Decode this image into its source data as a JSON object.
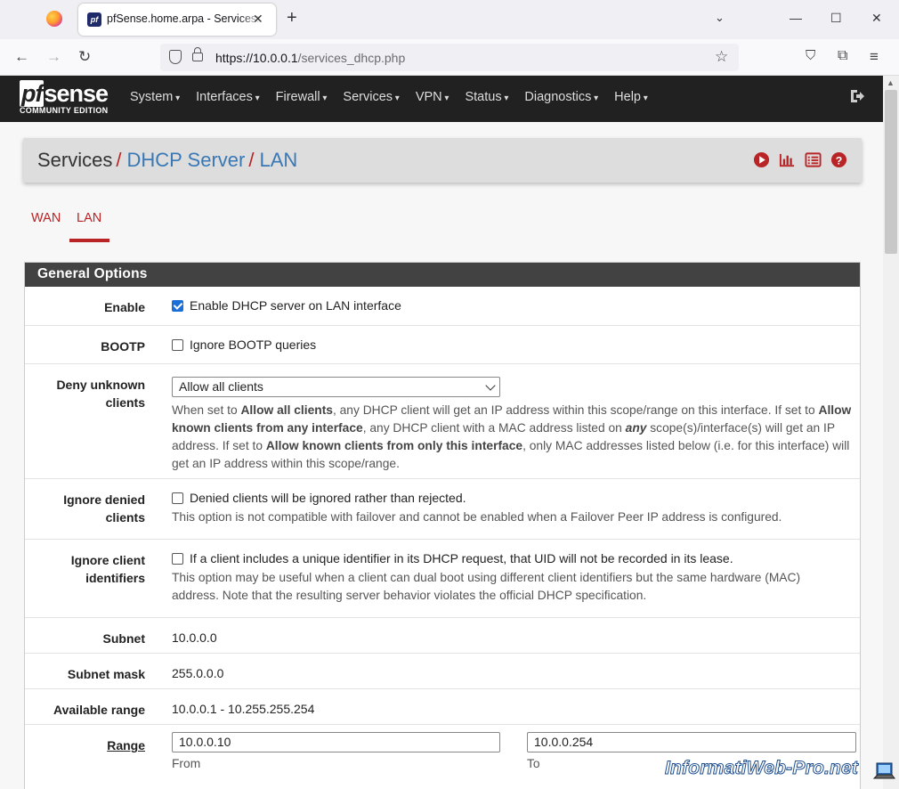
{
  "browser": {
    "tab_title": "pfSense.home.arpa - Services: DHCP Server: LAN",
    "tab_favicon": "pf",
    "url_host": "https://10.0.0.1",
    "url_path": "/services_dhcp.php"
  },
  "pf": {
    "logo_main": "sense",
    "logo_pf": "pf",
    "logo_sub": "COMMUNITY EDITION",
    "menu": [
      "System",
      "Interfaces",
      "Firewall",
      "Services",
      "VPN",
      "Status",
      "Diagnostics",
      "Help"
    ]
  },
  "breadcrumb": {
    "item1": "Services",
    "item2": "DHCP Server",
    "item3": "LAN",
    "separator": "/"
  },
  "tabs": {
    "wan": "WAN",
    "lan": "LAN"
  },
  "panel": {
    "heading": "General Options",
    "enable": {
      "label": "Enable",
      "text": "Enable DHCP server on LAN interface",
      "checked": true
    },
    "bootp": {
      "label": "BOOTP",
      "text": "Ignore BOOTP queries"
    },
    "deny_unknown": {
      "label_line1": "Deny unknown",
      "label_line2": "clients",
      "selected": "Allow all clients",
      "help_p1": "When set to ",
      "help_b1": "Allow all clients",
      "help_p2": ", any DHCP client will get an IP address within this scope/range on this interface. If set to ",
      "help_b2": "Allow known clients from any interface",
      "help_p3": ", any DHCP client with a MAC address listed on ",
      "help_b3": "any",
      "help_p4": " scope(s)/interface(s) will get an IP address. If set to ",
      "help_b4": "Allow known clients from only this interface",
      "help_p5": ", only MAC addresses listed below (i.e. for this interface) will get an IP address within this scope/range."
    },
    "ignore_denied": {
      "label_line1": "Ignore denied",
      "label_line2": "clients",
      "text": "Denied clients will be ignored rather than rejected.",
      "help": "This option is not compatible with failover and cannot be enabled when a Failover Peer IP address is configured."
    },
    "ignore_client_ids": {
      "label_line1": "Ignore client",
      "label_line2": "identifiers",
      "text": "If a client includes a unique identifier in its DHCP request, that UID will not be recorded in its lease.",
      "help": "This option may be useful when a client can dual boot using different client identifiers but the same hardware (MAC) address. Note that the resulting server behavior violates the official DHCP specification."
    },
    "subnet": {
      "label": "Subnet",
      "value": "10.0.0.0"
    },
    "subnet_mask": {
      "label": "Subnet mask",
      "value": "255.0.0.0"
    },
    "available_range": {
      "label": "Available range",
      "value": "10.0.0.1 - 10.255.255.254"
    },
    "range": {
      "label": "Range",
      "from_value": "10.0.0.10",
      "to_value": "10.0.0.254",
      "from_label": "From",
      "to_label": "To"
    }
  },
  "watermark": "InformatiWeb-Pro.net",
  "colors": {
    "accent_red": "#b92426",
    "link_blue": "#3a78b5",
    "nav_bg": "#212121",
    "checkbox_blue": "#1a6ed8"
  }
}
